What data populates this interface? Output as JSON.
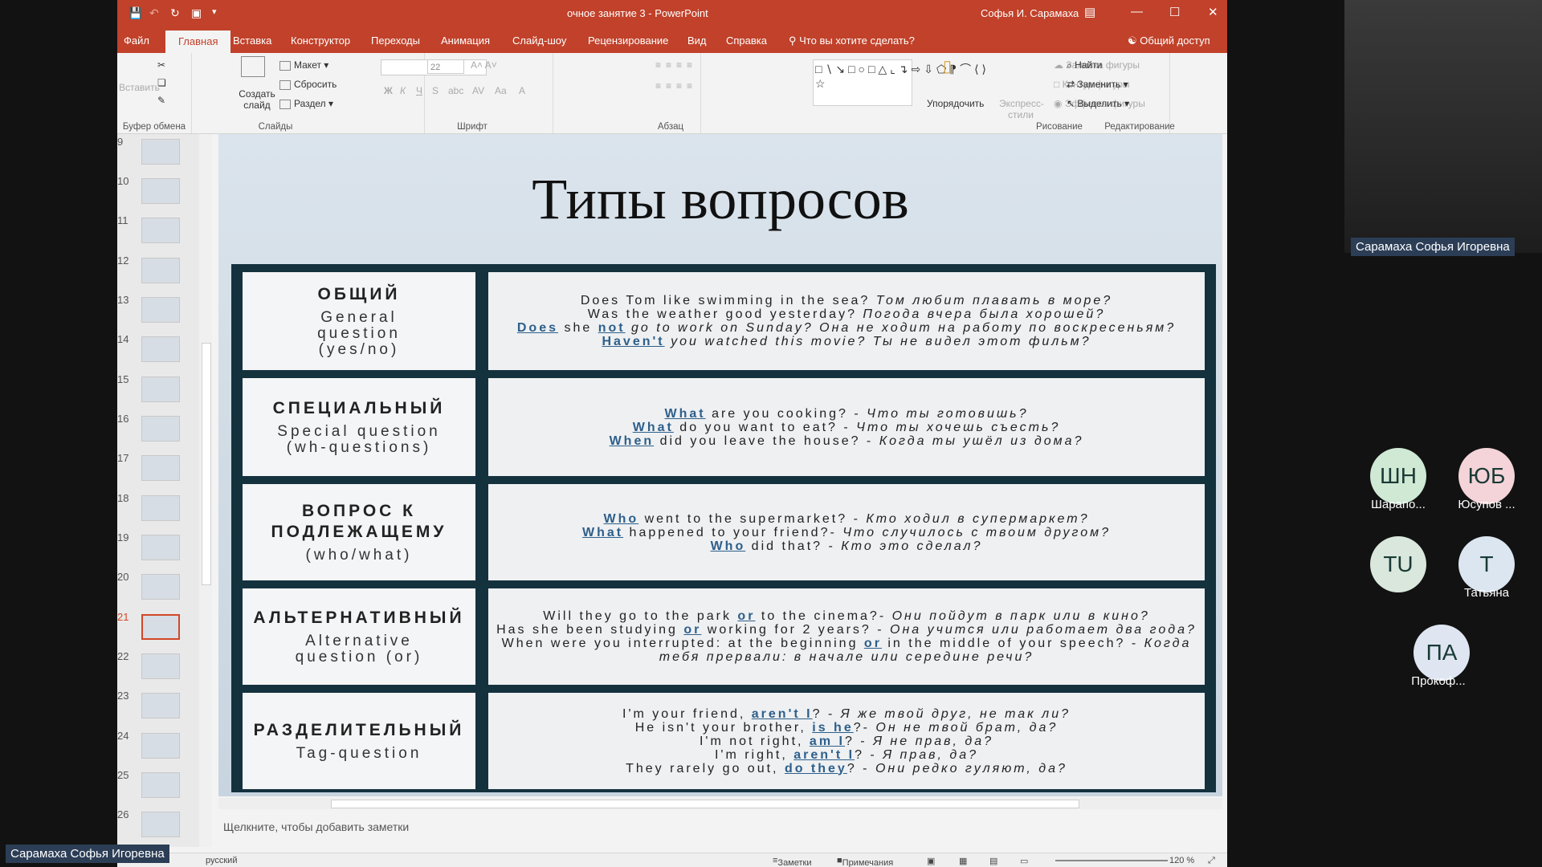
{
  "window": {
    "title": "очное занятие 3 - PowerPoint",
    "user": "Софья И. Сарамаха"
  },
  "tabs": [
    "Файл",
    "Главная",
    "Вставка",
    "Конструктор",
    "Переходы",
    "Анимация",
    "Слайд-шоу",
    "Рецензирование",
    "Вид",
    "Справка"
  ],
  "tell_me": "Что вы хотите сделать?",
  "share": "Общий доступ",
  "ribbon": {
    "clipboard": {
      "paste": "Вставить",
      "label": "Буфер обмена"
    },
    "slides": {
      "create": "Создать слайд",
      "layout": "Макет",
      "reset": "Сбросить",
      "section": "Раздел",
      "label": "Слайды"
    },
    "font": {
      "label": "Шрифт",
      "size": "22"
    },
    "paragraph": {
      "label": "Абзац"
    },
    "drawing": {
      "arrange": "Упорядочить",
      "styles": "Экспресс-стили",
      "fill": "Заливка фигуры",
      "outline": "Контур фигуры",
      "effects": "Эффекты фигуры",
      "label": "Рисование"
    },
    "editing": {
      "find": "Найти",
      "replace": "Заменить",
      "select": "Выделить",
      "label": "Редактирование"
    }
  },
  "thumbs": [
    "9",
    "10",
    "11",
    "12",
    "13",
    "14",
    "15",
    "16",
    "17",
    "18",
    "19",
    "20",
    "21",
    "22",
    "23",
    "24",
    "25",
    "26"
  ],
  "slide": {
    "title": "Типы вопросов",
    "rows": [
      {
        "cat": "ОБЩИЙ",
        "sub": "General\nquestion\n(yes/no)",
        "lines": [
          [
            [
              "Does Tom like swimming in the sea? ",
              "e"
            ],
            [
              "Том любит плавать в море?",
              "r"
            ]
          ],
          [
            [
              "Was the weather good yesterday? ",
              "e"
            ],
            [
              "Погода вчера была хорошей?",
              "r"
            ]
          ],
          [
            [
              "Does",
              "u"
            ],
            [
              " she ",
              "e"
            ],
            [
              "not",
              "u"
            ],
            [
              " go to work on Sunday? ",
              "r"
            ],
            [
              "Она не ходит на работу по воскресеньям?",
              "r"
            ]
          ],
          [
            [
              "Haven't",
              "u"
            ],
            [
              " you watched this movie? ",
              "r"
            ],
            [
              "Ты не видел этот фильм?",
              "r"
            ]
          ]
        ]
      },
      {
        "cat": "СПЕЦИАЛЬНЫЙ",
        "sub": "Special question\n(wh-questions)",
        "lines": [
          [
            [
              "What",
              "u"
            ],
            [
              " are you cooking? - ",
              "e"
            ],
            [
              "Что ты готовишь?",
              "r"
            ]
          ],
          [
            [
              "What",
              "u"
            ],
            [
              " do you want to eat? - ",
              "e"
            ],
            [
              "Что ты хочешь съесть?",
              "r"
            ]
          ],
          [
            [
              "When",
              "u"
            ],
            [
              " did you leave the house? - ",
              "e"
            ],
            [
              "Когда ты ушёл из дома?",
              "r"
            ]
          ]
        ]
      },
      {
        "cat": "ВОПРОС К\nПОДЛЕЖАЩЕМУ",
        "sub": "(who/what)",
        "lines": [
          [
            [
              "Who",
              "u"
            ],
            [
              " went to the supermarket? - ",
              "e"
            ],
            [
              "Кто ходил в супермаркет?",
              "r"
            ]
          ],
          [
            [
              "What",
              "u"
            ],
            [
              " happened to your friend?- ",
              "e"
            ],
            [
              "Что случилось с твоим другом?",
              "r"
            ]
          ],
          [
            [
              "Who",
              "u"
            ],
            [
              " did that? - ",
              "e"
            ],
            [
              "Кто это сделал?",
              "r"
            ]
          ]
        ]
      },
      {
        "cat": "АЛЬТЕРНАТИВНЫЙ",
        "sub": "Alternative\nquestion (or)",
        "lines": [
          [
            [
              "Will they go to the park ",
              "e"
            ],
            [
              "or",
              "u"
            ],
            [
              " to the cinema?- ",
              "e"
            ],
            [
              "Они пойдут в парк или в кино?",
              "r"
            ]
          ],
          [
            [
              "Has she been studying ",
              "e"
            ],
            [
              "or",
              "u"
            ],
            [
              " working for 2 years? - ",
              "e"
            ],
            [
              "Она учится или работает два года?",
              "r"
            ]
          ],
          [
            [
              "When were you interrupted: at the beginning ",
              "e"
            ],
            [
              "or",
              "u"
            ],
            [
              " in the middle of your speech? - ",
              "e"
            ],
            [
              "Когда тебя прервали: в начале или середине речи?",
              "r"
            ]
          ]
        ]
      },
      {
        "cat": "РАЗДЕЛИТЕЛЬНЫЙ",
        "sub": "Tag-question",
        "lines": [
          [
            [
              "I'm your friend, ",
              "e"
            ],
            [
              "aren't I",
              "u"
            ],
            [
              "? - ",
              "e"
            ],
            [
              "Я же твой друг, не так ли?",
              "r"
            ]
          ],
          [
            [
              "He isn't your brother, ",
              "e"
            ],
            [
              "is he",
              "u"
            ],
            [
              "?- ",
              "e"
            ],
            [
              "Он не твой брат, да?",
              "r"
            ]
          ],
          [
            [
              "I'm not right, ",
              "e"
            ],
            [
              "am I",
              "u"
            ],
            [
              "? - ",
              "e"
            ],
            [
              "Я не прав, да?",
              "r"
            ]
          ],
          [
            [
              "I'm right, ",
              "e"
            ],
            [
              "aren't I",
              "u"
            ],
            [
              "? - ",
              "e"
            ],
            [
              "Я прав, да?",
              "r"
            ]
          ],
          [
            [
              "They rarely go out, ",
              "e"
            ],
            [
              "do they",
              "u"
            ],
            [
              "? - ",
              "e"
            ],
            [
              "Они редко гуляют, да?",
              "r"
            ]
          ]
        ]
      }
    ]
  },
  "notes": "Щелкните, чтобы добавить заметки",
  "status": {
    "lang": "русский",
    "notes": "Заметки",
    "comments": "Примечания",
    "zoom": "120 %"
  },
  "participants": {
    "presenter": "Сарамаха Софья Игоревна",
    "list": [
      {
        "initials": "ШН",
        "name": "Шарапо...",
        "color": "#cfe9d4"
      },
      {
        "initials": "ЮБ",
        "name": "Юсупов ...",
        "color": "#f4d4d8"
      },
      {
        "initials": "TU",
        "name": "",
        "color": "#d9e7dc"
      },
      {
        "initials": "Т",
        "name": "Татьяна",
        "color": "#dbe6f1"
      },
      {
        "initials": "ПА",
        "name": "Прокоф...",
        "color": "#dfe6f2"
      }
    ]
  }
}
